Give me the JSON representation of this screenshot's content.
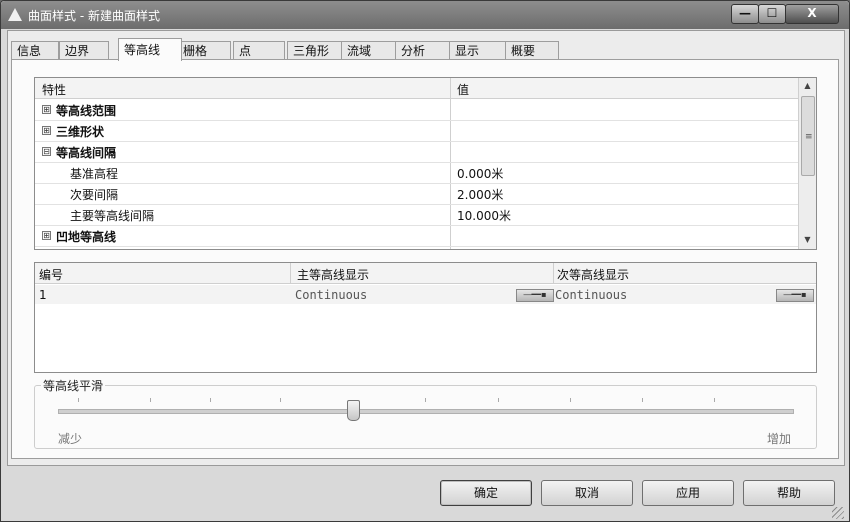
{
  "window": {
    "title": "曲面样式 - 新建曲面样式",
    "icon": "app-triangle-icon",
    "controls": {
      "minimize": "—",
      "maximize": "☐",
      "close": "X"
    }
  },
  "tabs": [
    {
      "label": "信息",
      "active": false
    },
    {
      "label": "边界",
      "active": false
    },
    {
      "label": "等高线",
      "active": true
    },
    {
      "label": "栅格",
      "active": false
    },
    {
      "label": "点",
      "active": false
    },
    {
      "label": "三角形",
      "active": false
    },
    {
      "label": "流域",
      "active": false
    },
    {
      "label": "分析",
      "active": false
    },
    {
      "label": "显示",
      "active": false
    },
    {
      "label": "概要",
      "active": false
    }
  ],
  "property_grid": {
    "headers": {
      "property": "特性",
      "value": "值"
    },
    "rows": [
      {
        "name": "等高线范围",
        "value": "",
        "expander": "⊞",
        "bold": true
      },
      {
        "name": "三维形状",
        "value": "",
        "expander": "⊞",
        "bold": true
      },
      {
        "name": "等高线间隔",
        "value": "",
        "expander": "⊟",
        "bold": true
      },
      {
        "name": "基准高程",
        "value": "0.000米",
        "expander": "",
        "bold": false
      },
      {
        "name": "次要间隔",
        "value": "2.000米",
        "expander": "",
        "bold": false
      },
      {
        "name": "主要等高线间隔",
        "value": "10.000米",
        "expander": "",
        "bold": false
      },
      {
        "name": "凹地等高线",
        "value": "",
        "expander": "⊞",
        "bold": true
      }
    ],
    "scrollbar": {
      "up": "▲",
      "down": "▼",
      "grip": "≡"
    }
  },
  "linetype_table": {
    "headers": {
      "number": "编号",
      "major": "主等高线显示",
      "minor": "次等高线显示"
    },
    "rows": [
      {
        "number": "1",
        "major": "Continuous",
        "minor": "Continuous"
      }
    ],
    "linetype_button_glyph": "―━━▪"
  },
  "smoothing": {
    "title": "等高线平滑",
    "min_label": "减少",
    "max_label": "增加",
    "value": 0.4
  },
  "buttons": {
    "ok": "确定",
    "cancel": "取消",
    "apply": "应用",
    "help": "帮助"
  }
}
